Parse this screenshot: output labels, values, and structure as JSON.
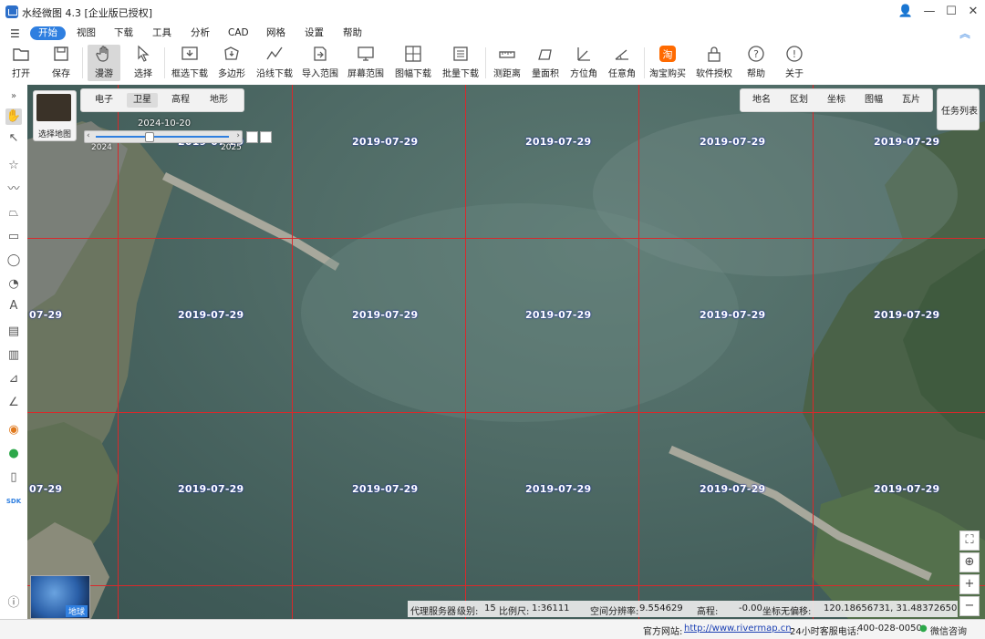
{
  "window": {
    "title": "水经微图 4.3 [企业版已授权]",
    "controls": [
      "👤",
      "—",
      "☐",
      "✕"
    ]
  },
  "menu": {
    "items": [
      "开始",
      "视图",
      "下载",
      "工具",
      "分析",
      "CAD",
      "网格",
      "设置",
      "帮助"
    ],
    "active": "开始"
  },
  "toolbar": {
    "items": [
      {
        "label": "打开",
        "icon": "folder-icon"
      },
      {
        "label": "保存",
        "icon": "save-icon"
      },
      {
        "label": "漫游",
        "icon": "hand-icon",
        "active": true
      },
      {
        "label": "选择",
        "icon": "pointer-icon"
      },
      {
        "label": "框选下载",
        "icon": "box-download-icon"
      },
      {
        "label": "多边形",
        "icon": "polygon-download-icon"
      },
      {
        "label": "沿线下载",
        "icon": "line-download-icon"
      },
      {
        "label": "导入范围",
        "icon": "import-range-icon"
      },
      {
        "label": "屏幕范围",
        "icon": "screen-range-icon"
      },
      {
        "label": "图幅下载",
        "icon": "sheet-download-icon"
      },
      {
        "label": "批量下载",
        "icon": "batch-download-icon"
      },
      {
        "label": "测距离",
        "icon": "ruler-icon"
      },
      {
        "label": "量面积",
        "icon": "area-icon"
      },
      {
        "label": "方位角",
        "icon": "bearing-icon"
      },
      {
        "label": "任意角",
        "icon": "angle-icon"
      },
      {
        "label": "淘宝购买",
        "icon": "taobao-icon"
      },
      {
        "label": "软件授权",
        "icon": "lock-icon"
      },
      {
        "label": "帮助",
        "icon": "help-icon"
      },
      {
        "label": "关于",
        "icon": "info-icon"
      }
    ]
  },
  "map_panel": {
    "select_map_label": "选择地图",
    "layer_tabs": [
      "电子",
      "卫星",
      "高程",
      "地形"
    ],
    "active_layer": "卫星",
    "timeline": {
      "current_date": "2024-10-20",
      "year_start": "2024",
      "year_end": "2025",
      "position": 0.4
    },
    "overlay_tabs": [
      "地名",
      "区划",
      "坐标",
      "图幅",
      "瓦片"
    ],
    "task_list": "任务列表",
    "globe_label": "地球"
  },
  "tile_dates": {
    "label": "2019-07-29",
    "partial": "07-29"
  },
  "info": {
    "proxy": "代理服务器",
    "level_label": "级别:",
    "level": "15",
    "scale_label": "比例尺:",
    "scale": "1:36111",
    "resolution_label": "空间分辨率:",
    "resolution": "9.554629",
    "elevation_label": "高程:",
    "elevation": "-0.00",
    "offset_label": "坐标无偏移:",
    "coords": "120.18656731, 31.48372650"
  },
  "status": {
    "website_label": "官方网站:",
    "website": "http://www.rivermap.cn",
    "phone_label": "24小时客服电话:",
    "phone": "400-028-0050",
    "wechat": "微信咨询"
  },
  "colors": {
    "accent": "#2f7fe0",
    "grid": "#d8292b",
    "water": "#4f6b66"
  }
}
